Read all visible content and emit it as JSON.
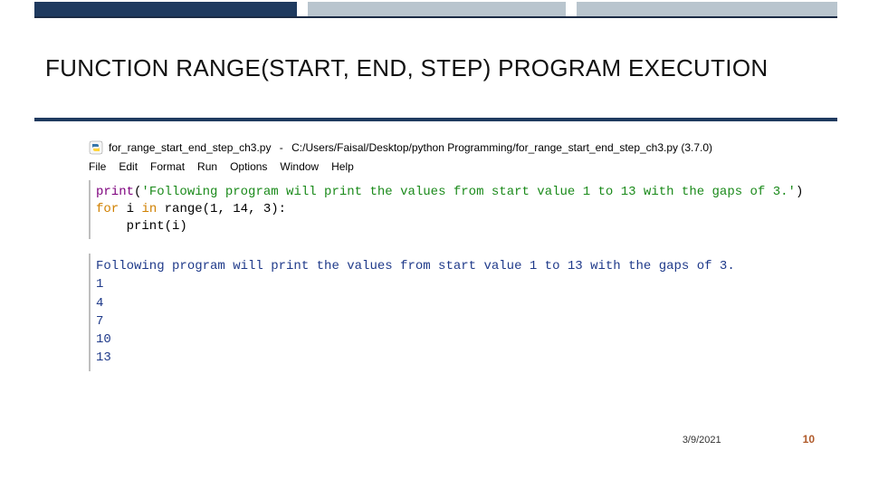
{
  "slide": {
    "title": "FUNCTION RANGE(START, END, STEP) PROGRAM EXECUTION"
  },
  "window": {
    "file_label": "for_range_start_end_step_ch3.py",
    "path_label": "C:/Users/Faisal/Desktop/python Programming/for_range_start_end_step_ch3.py (3.7.0)"
  },
  "menu": {
    "file": "File",
    "edit": "Edit",
    "format": "Format",
    "run": "Run",
    "options": "Options",
    "window": "Window",
    "help": "Help"
  },
  "code": {
    "kw_print": "print",
    "paren_open": "(",
    "string": "'Following program will print the values from start value 1 to 13 with the gaps of 3.'",
    "paren_close": ")",
    "kw_for": "for",
    "ident_i": " i ",
    "kw_in": "in",
    "range_call": " range(1, 14, 3):",
    "body": "    print(i)"
  },
  "output": {
    "line0": "Following program will print the values from start value 1 to 13 with the gaps of 3.",
    "line1": "1",
    "line2": "4",
    "line3": "7",
    "line4": "10",
    "line5": "13"
  },
  "footer": {
    "date": "3/9/2021",
    "page": "10"
  }
}
